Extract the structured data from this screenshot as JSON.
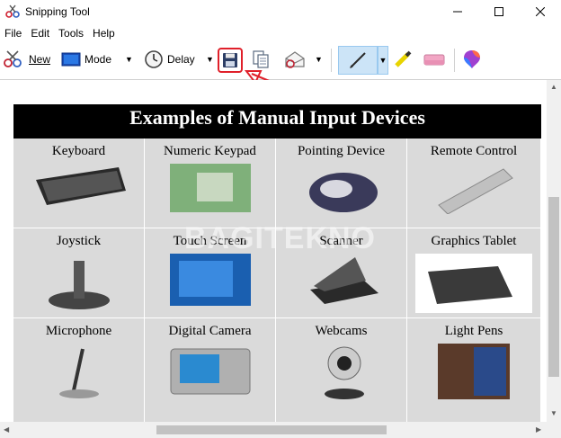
{
  "window": {
    "title": "Snipping Tool"
  },
  "menu": [
    "File",
    "Edit",
    "Tools",
    "Help"
  ],
  "toolbar": {
    "new_label": "New",
    "mode_label": "Mode",
    "delay_label": "Delay"
  },
  "document": {
    "title": "Examples of Manual Input Devices",
    "watermark": "BAGITEKNO",
    "devices": [
      "Keyboard",
      "Numeric Keypad",
      "Pointing Device",
      "Remote Control",
      "Joystick",
      "Touch Screen",
      "Scanner",
      "Graphics Tablet",
      "Microphone",
      "Digital Camera",
      "Webcams",
      "Light Pens"
    ]
  },
  "colors": {
    "highlight_red": "#e0202a",
    "pen_active": "#cce4f7",
    "header_bg": "#000000"
  },
  "icons": {
    "app": "scissors-icon",
    "save": "floppy-disk-icon",
    "copy": "copy-icon",
    "send": "envelope-icon",
    "pen": "pen-icon",
    "highlighter": "highlighter-icon",
    "eraser": "eraser-icon",
    "paint3d": "paint-3d-icon"
  }
}
